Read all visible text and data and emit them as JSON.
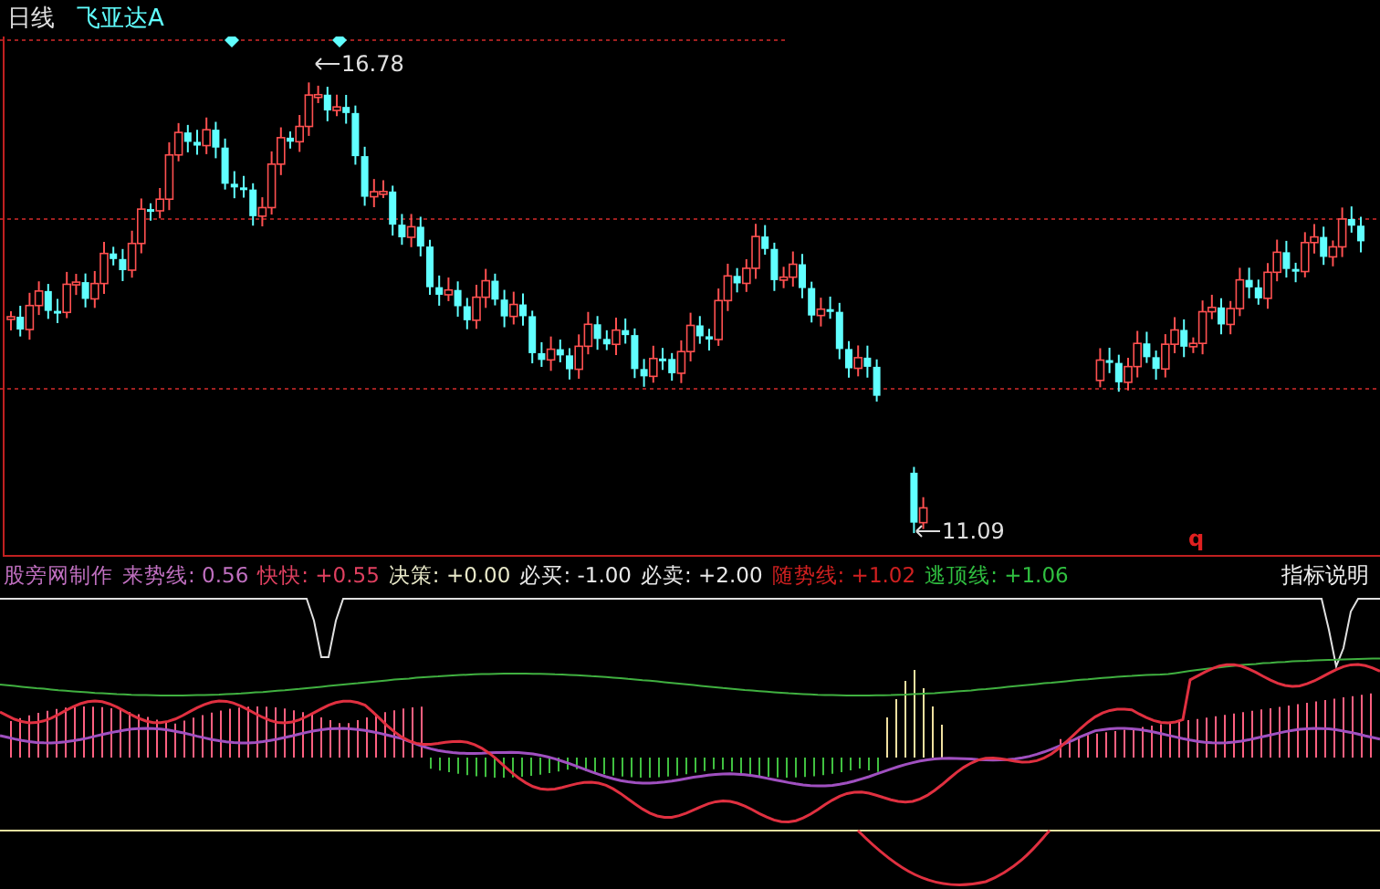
{
  "header": {
    "period": "日线",
    "stock": "飞亚达A"
  },
  "price_labels": {
    "high": "16.78",
    "low": "11.09"
  },
  "marker": "q",
  "legend": {
    "title": "股旁网制作",
    "items": [
      {
        "text": "来势线: 0.56",
        "color": "#c070c0"
      },
      {
        "text": "快快: +0.55",
        "color": "#e04060"
      },
      {
        "text": "决策: +0.00",
        "color": "#e8e8c8"
      },
      {
        "text": "必买: -1.00",
        "color": "#e8e8e8"
      },
      {
        "text": "必卖: +2.00",
        "color": "#e8e8e8"
      },
      {
        "text": "随势线: +1.02",
        "color": "#d02020"
      },
      {
        "text": "逃顶线: +1.06",
        "color": "#30c040"
      }
    ],
    "button": "指标说明"
  }
}
